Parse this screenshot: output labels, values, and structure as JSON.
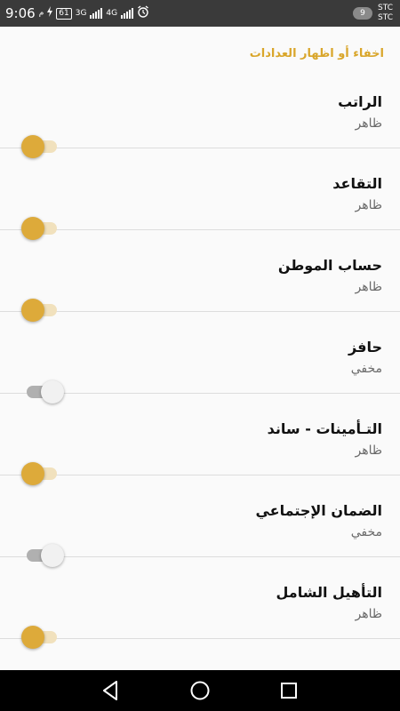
{
  "status_bar": {
    "time": "9:06",
    "am_pm_marker": "م",
    "battery_level": "61",
    "network_a": "3G",
    "network_b": "4G",
    "notification_count": "9",
    "carrier_1": "STC",
    "carrier_2": "STC",
    "icons": [
      "charging-icon",
      "signal-icon",
      "alarm-icon"
    ]
  },
  "section_header": "اخفاء أو اظهار العدادات",
  "rows": [
    {
      "title": "الراتب",
      "status": "ظاهر",
      "enabled": true
    },
    {
      "title": "التقاعد",
      "status": "ظاهر",
      "enabled": true
    },
    {
      "title": "حساب الموطن",
      "status": "ظاهر",
      "enabled": true
    },
    {
      "title": "حافز",
      "status": "مخفي",
      "enabled": false
    },
    {
      "title": "التـأمينات - ساند",
      "status": "ظاهر",
      "enabled": true
    },
    {
      "title": "الضمان الإجتماعي",
      "status": "مخفي",
      "enabled": false
    },
    {
      "title": "التأهيل الشامل",
      "status": "ظاهر",
      "enabled": true
    }
  ],
  "colors": {
    "accent": "#d9a62b",
    "toggle_on_thumb": "#ddaa3a",
    "toggle_on_track": "#f1e1bd",
    "toggle_off_thumb": "#f1f1f1",
    "toggle_off_track": "#b0b0b0",
    "status_bar": "#3a3a3a",
    "nav_bar": "#000000"
  },
  "nav_bar": {
    "buttons": [
      "back-icon",
      "home-icon",
      "recents-icon"
    ]
  }
}
